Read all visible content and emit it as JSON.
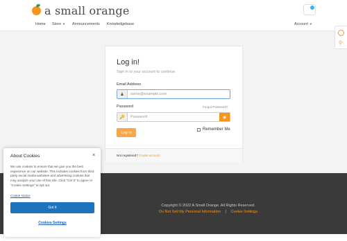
{
  "header": {
    "brand": "a small orange",
    "nav": {
      "home": "Home",
      "store": "Store",
      "announcements": "Announcements",
      "knowledgebase": "Knowledgebase",
      "account": "Account"
    }
  },
  "login": {
    "title": "Log in!",
    "subtitle": "Sign in to your account to continue",
    "email_label": "Email Address",
    "email_placeholder": "name@example.com",
    "password_label": "Password",
    "forgot": "Forgot Password?",
    "password_placeholder": "Password",
    "login_button": "Log In",
    "remember_me": "Remember Me",
    "not_registered": "Not registered?",
    "create_account": "Create account"
  },
  "footer": {
    "copyright": "Copyright © 2022 A Small Orange. All Rights Reserved.",
    "dnsmpi": "Do Not Sell My Personal Information",
    "separator": "|",
    "cookie_settings": "Cookie Settings"
  },
  "cookie_banner": {
    "title": "About Cookies",
    "close": "×",
    "body": "We use cookies to ensure that we give you the best experience on our website. This includes cookies from third party social media websites and advertising cookies that may analyze your use of this site. Click \"Got it\" to agree or \"Cookie Settings\" to opt out.",
    "notice_link": "Cookie Notice",
    "got_it": "Got It",
    "settings": "Cookies Settings"
  },
  "colors": {
    "accent": "#f7941d",
    "primary_blue": "#1e73be",
    "footer_bg": "#3a3a3a"
  },
  "icons": {
    "user": "user-icon",
    "key": "key-icon",
    "eye": "eye-icon",
    "cart": "cart-icon"
  }
}
